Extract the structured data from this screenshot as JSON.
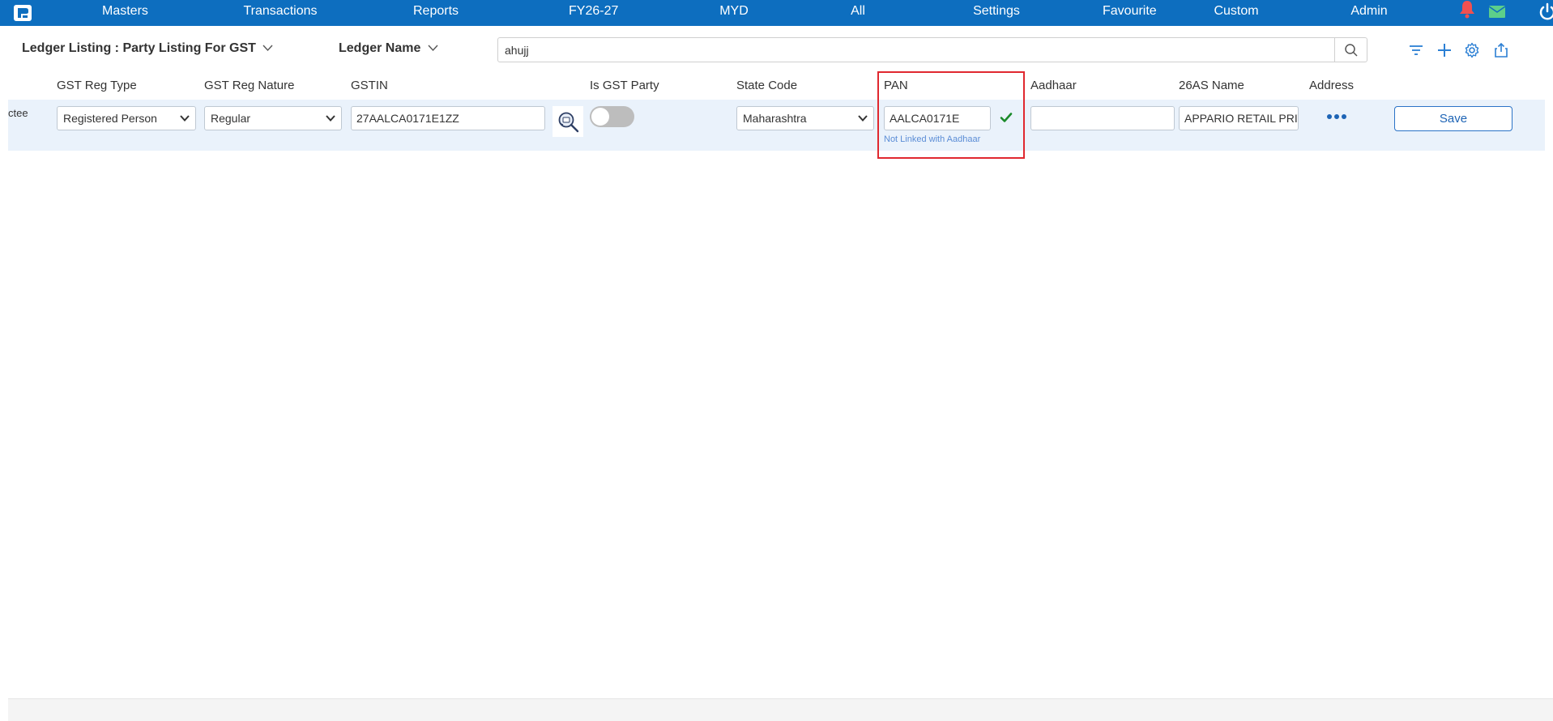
{
  "nav": {
    "items": [
      "Masters",
      "Transactions",
      "Reports",
      "FY26-27",
      "MYD",
      "All",
      "Settings",
      "Favourite",
      "Custom",
      "Admin"
    ]
  },
  "toolbar": {
    "listing_title": "Ledger Listing : Party Listing For GST",
    "field_selector": "Ledger Name",
    "search_value": "ahujj"
  },
  "table": {
    "columns": [
      "GST Reg Type",
      "GST Reg Nature",
      "GSTIN",
      "Is GST Party",
      "State Code",
      "PAN",
      "Aadhaar",
      "26AS Name",
      "Address"
    ],
    "row": {
      "partial_name": "ctee",
      "gst_reg_type": "Registered Person",
      "gst_reg_nature": "Regular",
      "gstin": "27AALCA0171E1ZZ",
      "is_gst_party": false,
      "state_code": "Maharashtra",
      "pan": "AALCA0171E",
      "pan_note": "Not Linked with Aadhaar",
      "aadhaar": "",
      "name_26as": "APPARIO RETAIL PRIV",
      "save_label": "Save"
    }
  },
  "colors": {
    "nav_bg": "#0d6ebf",
    "row_bg": "#eaf2fb",
    "highlight_border": "#e0282f",
    "valid_check": "#1a8a2a",
    "note_text": "#5b8dd6"
  },
  "icons": [
    "app-logo-icon",
    "bell-icon",
    "mail-icon",
    "power-icon",
    "chevron-down-icon",
    "search-icon",
    "filter-icon",
    "plus-icon",
    "gear-icon",
    "export-icon",
    "gstin-lookup-icon",
    "check-icon",
    "more-dots-icon"
  ]
}
